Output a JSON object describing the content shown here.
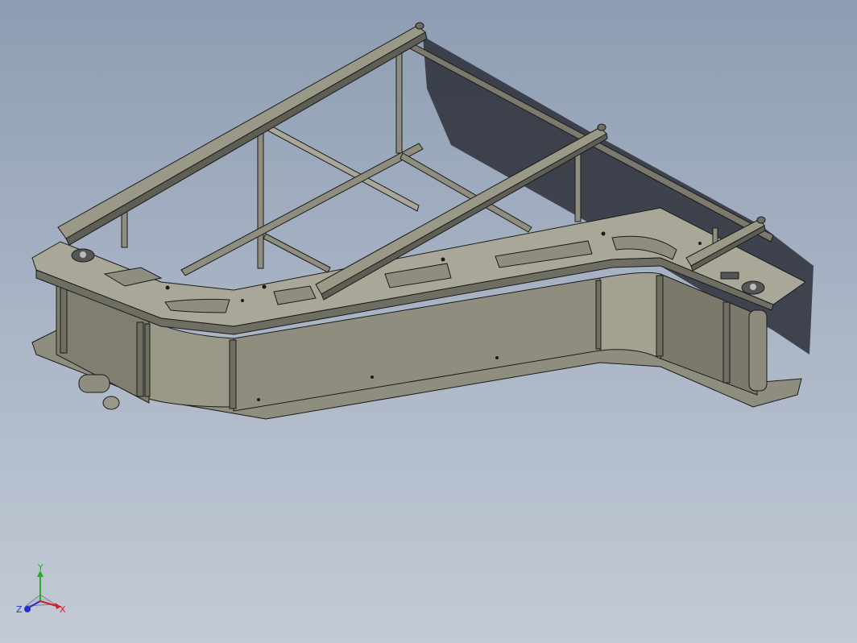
{
  "viewport": {
    "background_top": "#8e9db3",
    "background_bottom": "#c3cad5"
  },
  "model": {
    "body_color": "#8f8e7e",
    "body_light_color": "#a9a898",
    "body_dark_color": "#6f6e62",
    "edge_color": "#1a1a1a",
    "shadow_color": "#2b2f38"
  },
  "triad": {
    "x_label": "X",
    "y_label": "Y",
    "z_label": "Z",
    "x_color": "#d42020",
    "y_color": "#20b020",
    "z_color": "#2030d0"
  }
}
